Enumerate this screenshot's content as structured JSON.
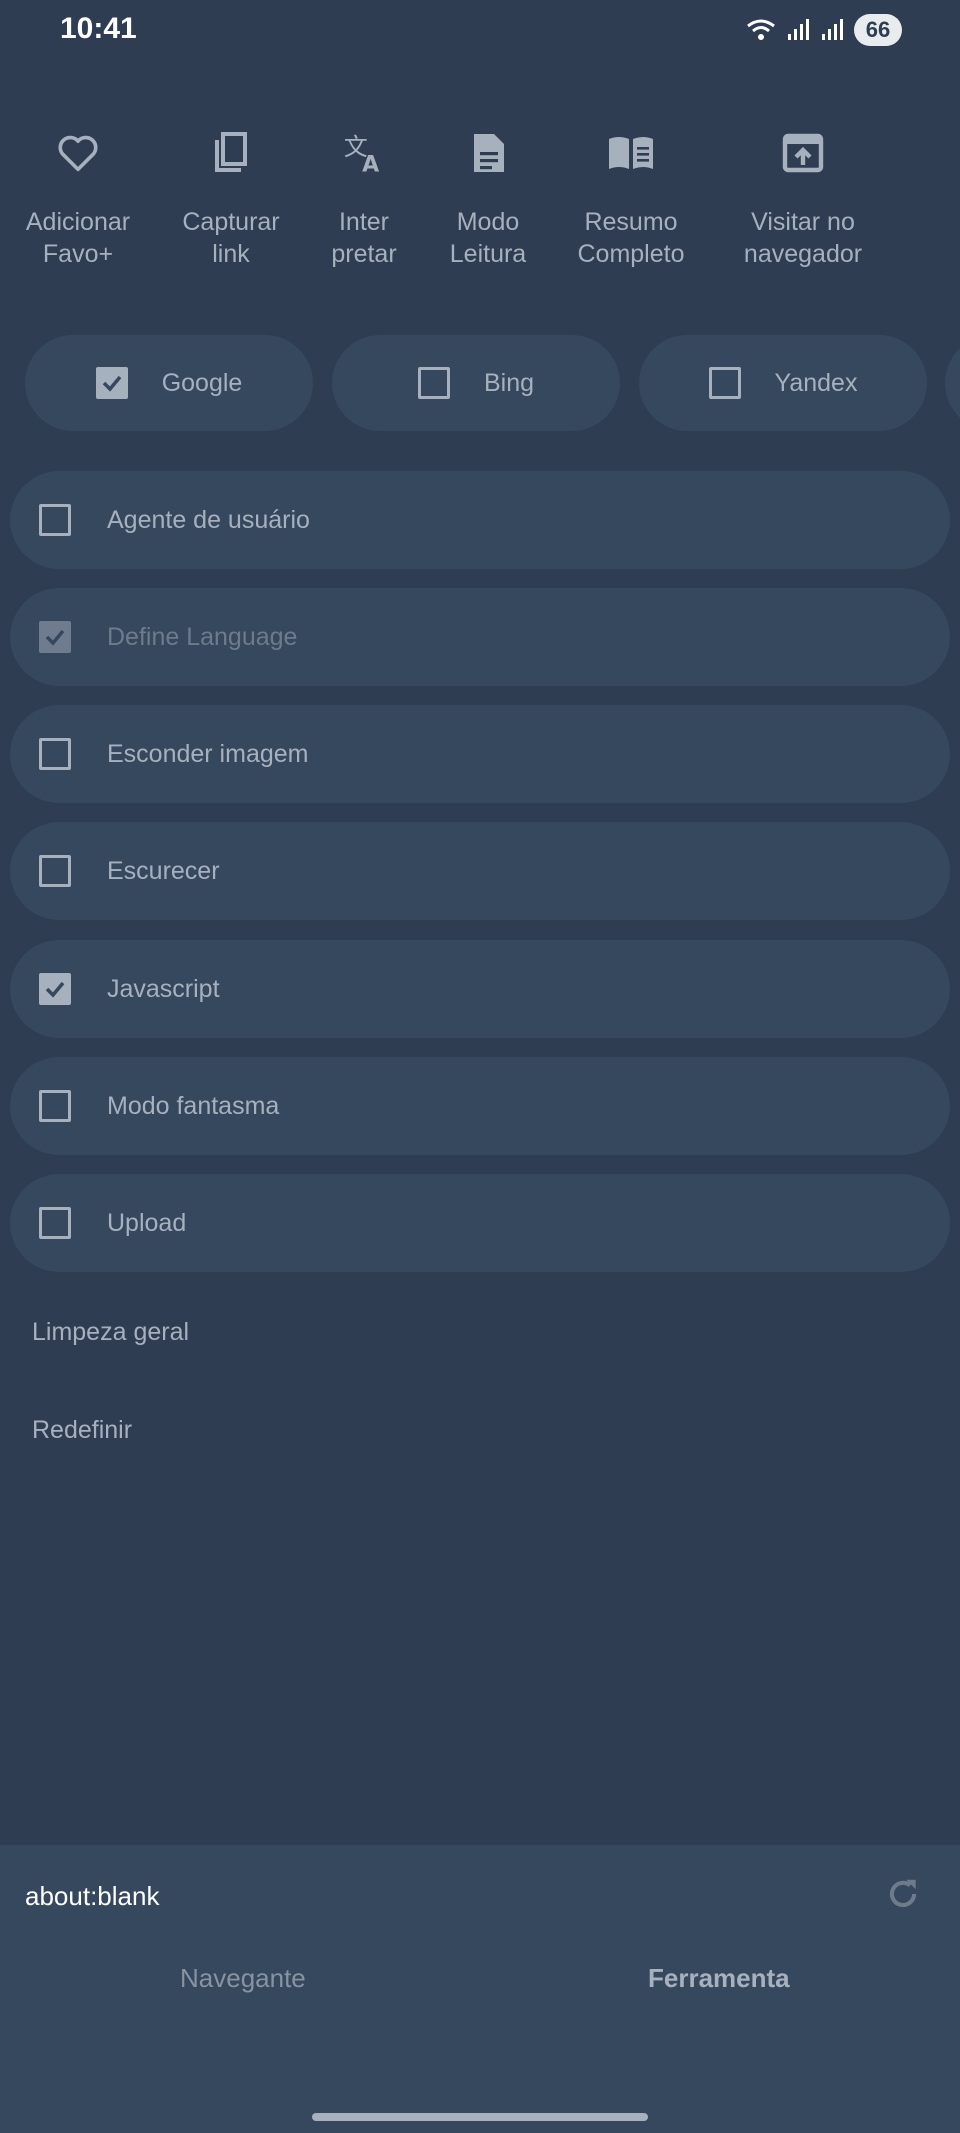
{
  "status": {
    "time": "10:41",
    "battery": "66",
    "icons": [
      "wifi-icon",
      "signal-icon",
      "signal-icon",
      "battery-icon"
    ]
  },
  "tools": [
    {
      "icon": "heart-icon",
      "label": "Adicionar\nFavo+"
    },
    {
      "icon": "copy-icon",
      "label": "Capturar\nlink"
    },
    {
      "icon": "translate-icon",
      "label": "Inter\npretar"
    },
    {
      "icon": "document-icon",
      "label": "Modo\nLeitura"
    },
    {
      "icon": "book-icon",
      "label": "Resumo\nCompleto"
    },
    {
      "icon": "open-in-browser-icon",
      "label": "Visitar no\nnavegador"
    }
  ],
  "engines": [
    {
      "label": "Google",
      "checked": true
    },
    {
      "label": "Bing",
      "checked": false
    },
    {
      "label": "Yandex",
      "checked": false
    }
  ],
  "options": [
    {
      "label": "Agente de usuário",
      "checked": false,
      "disabled": false
    },
    {
      "label": "Define Language",
      "checked": true,
      "disabled": true
    },
    {
      "label": "Esconder imagem",
      "checked": false,
      "disabled": false
    },
    {
      "label": "Escurecer",
      "checked": false,
      "disabled": false
    },
    {
      "label": "Javascript",
      "checked": true,
      "disabled": false
    },
    {
      "label": "Modo fantasma",
      "checked": false,
      "disabled": false
    },
    {
      "label": "Upload",
      "checked": false,
      "disabled": false
    }
  ],
  "actions": {
    "clear_all": "Limpeza geral",
    "reset": "Redefinir"
  },
  "bottom": {
    "url": "about:blank",
    "tabs": [
      {
        "label": "Navegante",
        "active": false
      },
      {
        "label": "Ferramenta",
        "active": true
      }
    ]
  },
  "colors": {
    "background": "#2e3d51",
    "surface": "#35485e",
    "text": "#a7b1bd"
  }
}
